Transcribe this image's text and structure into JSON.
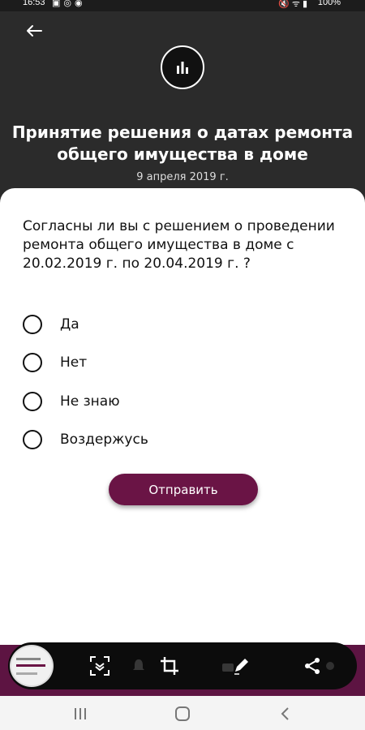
{
  "status_bar": {
    "time": "16:53",
    "left_icons": [
      "image-icon",
      "whatsapp-icon",
      "notification-icon"
    ],
    "right_icons": [
      "mute-icon",
      "wifi-icon",
      "signal-icon"
    ],
    "battery": "100%"
  },
  "header": {
    "background": "#2b2b2b",
    "back_icon": "arrow-left-icon",
    "badge_icon": "bar-chart-icon",
    "title": "Принятие решения о датах ремонта общего имущества в доме",
    "date": "9 апреля 2019 г."
  },
  "poll": {
    "question": "Согласны ли вы с решением о проведении ремонта общего имущества в доме с 20.02.2019 г. по 20.04.2019 г. ?",
    "options": [
      {
        "label": "Да",
        "selected": false
      },
      {
        "label": "Нет",
        "selected": false
      },
      {
        "label": "Не знаю",
        "selected": false
      },
      {
        "label": "Воздержусь",
        "selected": false
      }
    ],
    "submit_label": "Отправить",
    "accent_color": "#6a1445"
  },
  "screenshot_toolbar": {
    "tools": [
      "screenshot-thumbnail",
      "scroll-capture-icon",
      "crop-icon",
      "pencil-icon",
      "share-icon"
    ]
  },
  "nav_bar": {
    "buttons": [
      "recents-icon",
      "home-icon",
      "back-icon"
    ]
  }
}
